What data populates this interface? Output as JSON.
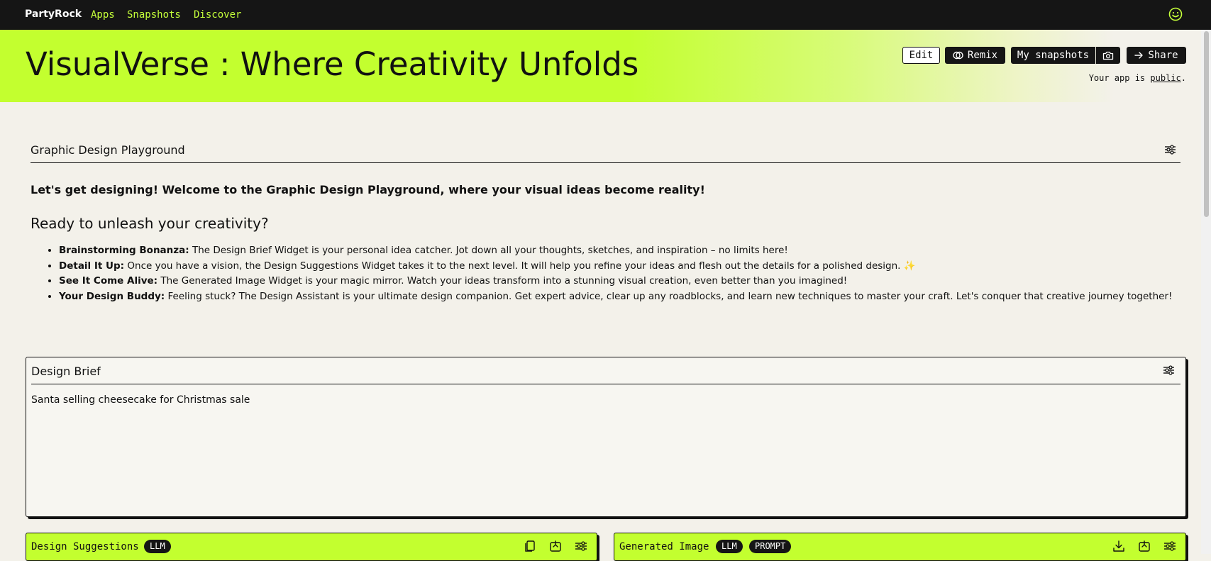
{
  "nav": {
    "brand": "PartyRock",
    "links": [
      "Apps",
      "Snapshots",
      "Discover"
    ],
    "profile_icon": "smiley-icon"
  },
  "header": {
    "title": "VisualVerse : Where Creativity Unfolds",
    "buttons": {
      "edit": "Edit",
      "remix": "Remix",
      "snapshots": "My snapshots",
      "share": "Share"
    },
    "public_note_prefix": "Your app is",
    "public_note_link": "public",
    "public_note_suffix": ".",
    "accent_color": "#c3ff2f"
  },
  "intro": {
    "title": "Graphic Design Playground",
    "welcome": "Let's get designing! Welcome to the Graphic Design Playground, where your visual ideas become reality!",
    "heading": "Ready to unleash your creativity?",
    "bullets": [
      {
        "label": "Brainstorming Bonanza:",
        "text": " The Design Brief Widget is your personal idea catcher. Jot down all your thoughts, sketches, and inspiration – no limits here!"
      },
      {
        "label": "Detail It Up:",
        "text": " Once you have a vision, the Design Suggestions Widget takes it to the next level. It will help you refine your ideas and flesh out the details for a polished design. ✨"
      },
      {
        "label": "See It Come Alive:",
        "text": " The Generated Image Widget is your magic mirror. Watch your ideas transform into a stunning visual creation, even better than you imagined!"
      },
      {
        "label": "Your Design Buddy:",
        "text": " Feeling stuck? The Design Assistant is your ultimate design companion. Get expert advice, clear up any roadblocks, and learn new techniques to master your craft. Let's conquer that creative journey together!"
      }
    ]
  },
  "design_brief": {
    "title": "Design Brief",
    "value": "Santa selling cheesecake for Christmas sale"
  },
  "widgets": {
    "suggestions": {
      "title": "Design Suggestions",
      "badges": [
        "LLM"
      ]
    },
    "image": {
      "title": "Generated Image",
      "badges": [
        "LLM",
        "PROMPT"
      ]
    }
  }
}
